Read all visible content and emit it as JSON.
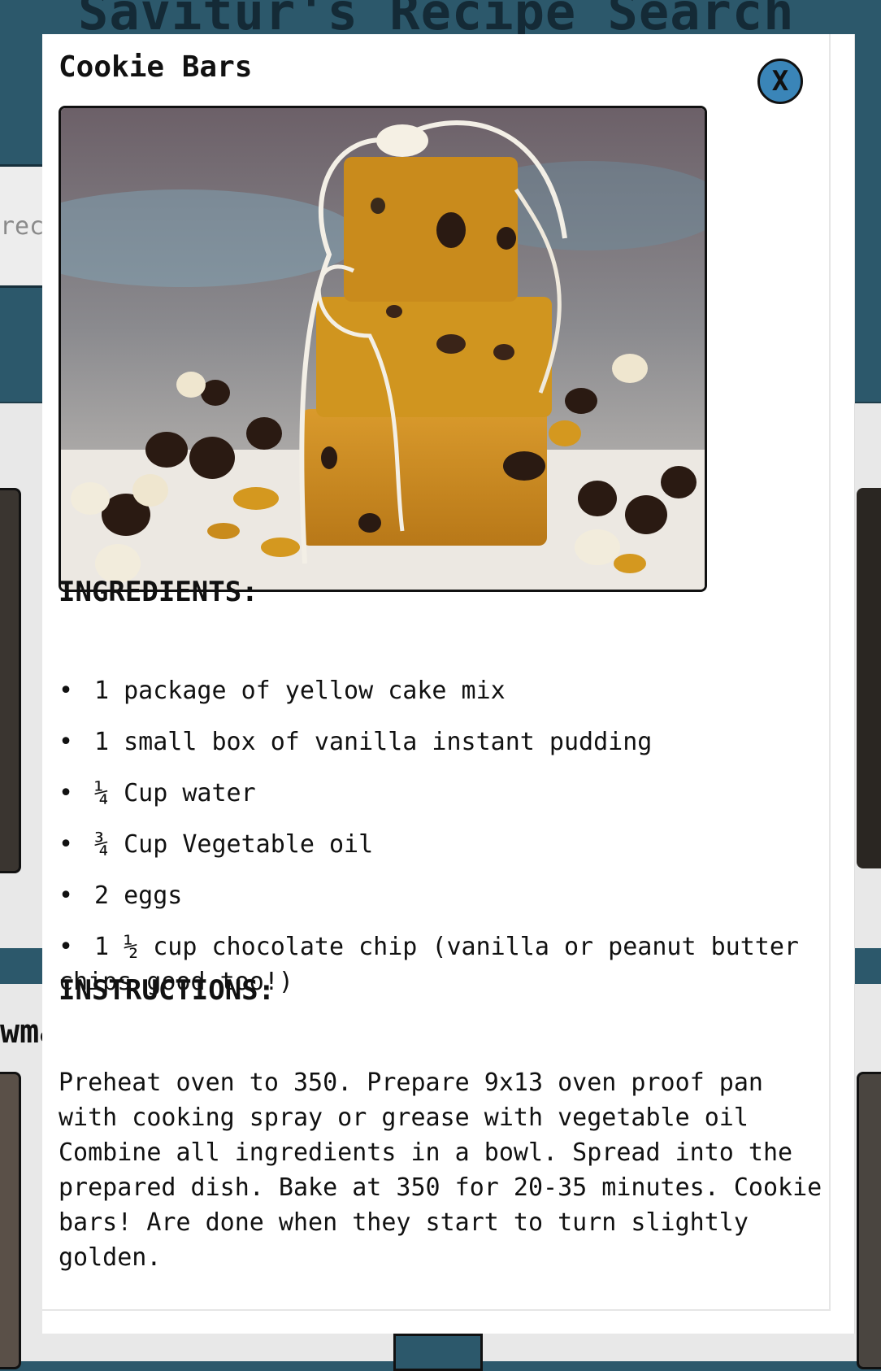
{
  "page": {
    "title": "Savitur's Recipe Search",
    "search_placeholder_fragment": "rec",
    "section_fragment": "wma"
  },
  "modal": {
    "close_label": "X",
    "recipe_title": "Cookie Bars",
    "image_alt": "stack of cookie bars tied with twine",
    "ingredients_heading": "INGREDIENTS:",
    "ingredients": [
      "1 package of yellow cake mix",
      "1 small box of vanilla instant pudding",
      "¼ Cup water",
      "¾ Cup Vegetable oil",
      "2 eggs",
      "1 ½ cup chocolate chip (vanilla or peanut butter chips good too!)"
    ],
    "instructions_heading": "INSTRUCTIONS:",
    "instructions": "Preheat oven to 350. Prepare 9x13 oven proof pan with cooking spray or grease with vegetable oil Combine all ingredients in a bowl. Spread into the prepared dish. Bake at 350 for 20-35 minutes. Cookie bars! Are done when they start to turn slightly golden."
  },
  "colors": {
    "page_background": "#2c586b",
    "close_button": "#3a85b8",
    "modal_background": "#ffffff"
  }
}
